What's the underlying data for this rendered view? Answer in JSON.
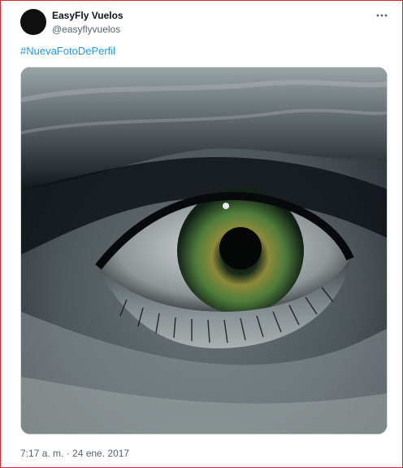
{
  "tweet": {
    "author_name": "EasyFly Vuelos",
    "author_handle": "@easyflyvuelos",
    "text": "#NuevaFotoDePerfil",
    "timestamp": "7:17 a. m. · 24 ene. 2017"
  },
  "icons": {
    "more": "more-horizontal-icon"
  },
  "colors": {
    "link": "#1d9bf0",
    "secondary_text": "#536471",
    "frame_border": "#d8262b",
    "iris": "#4f7d3a"
  }
}
